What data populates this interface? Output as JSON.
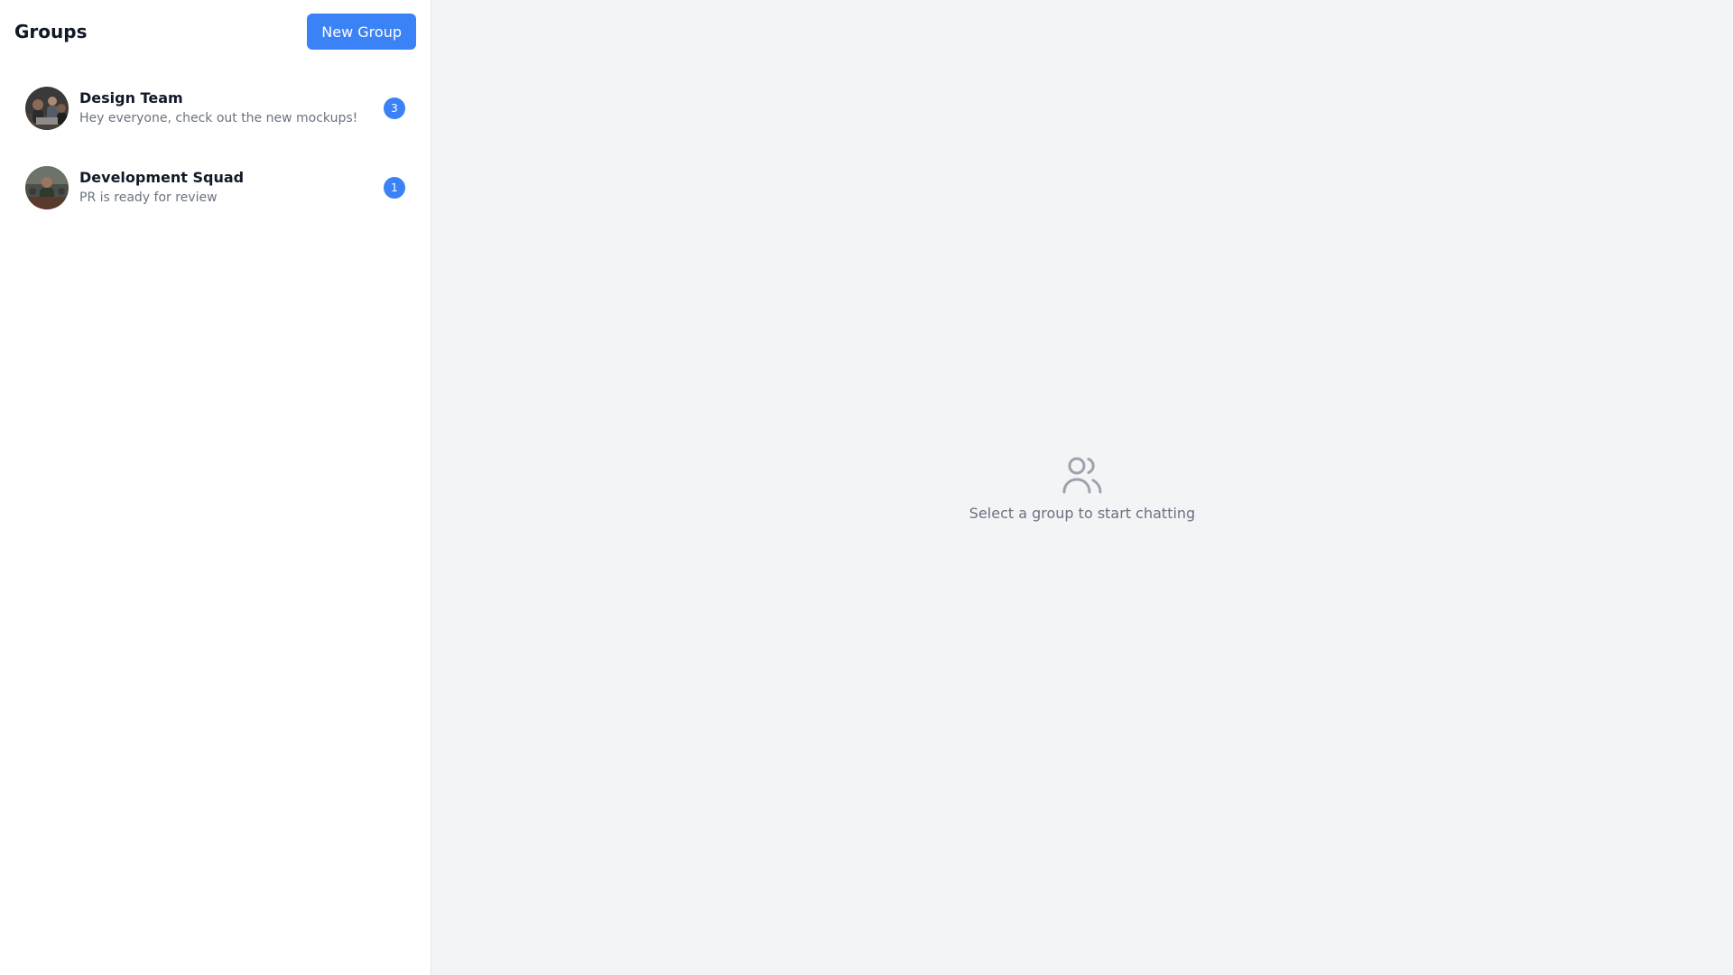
{
  "sidebar": {
    "title": "Groups",
    "new_group_label": "New Group",
    "groups": [
      {
        "name": "Design Team",
        "last_message": "Hey everyone, check out the new mockups!",
        "unread": "3",
        "avatar": "group-photo"
      },
      {
        "name": "Development Squad",
        "last_message": "PR is ready for review",
        "unread": "1",
        "avatar": "group-photo"
      }
    ]
  },
  "main": {
    "empty_icon": "users-icon",
    "empty_message": "Select a group to start chatting"
  },
  "colors": {
    "accent": "#3b82f6",
    "sidebar_bg": "#ffffff",
    "main_bg": "#f3f4f6",
    "muted_text": "#6b7280"
  }
}
